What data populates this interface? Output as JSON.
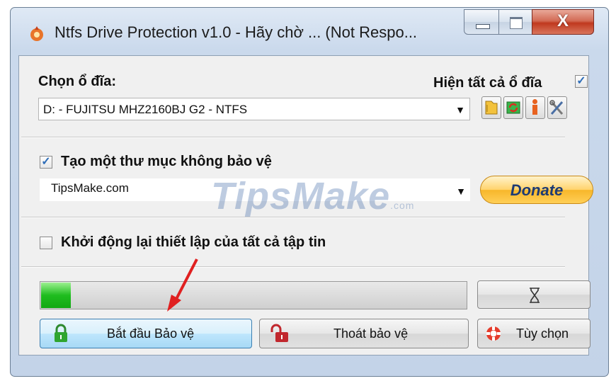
{
  "window": {
    "title": "Ntfs Drive Protection v1.0 - Hãy chờ ... (Not Respo...",
    "close_symbol": "X"
  },
  "drive": {
    "label": "Chọn ổ đĩa:",
    "show_all_label": "Hiện tất cả ổ đĩa",
    "show_all_checked": true,
    "selected": "D: - FUJITSU MHZ2160BJ G2 - NTFS",
    "tool_icons": [
      "folder-icon",
      "refresh-icon",
      "info-icon",
      "tools-icon"
    ]
  },
  "folder": {
    "checkbox_label": "Tạo một thư mục không bảo vệ",
    "checked": true,
    "value": "TipsMake.com",
    "donate_label": "Donate"
  },
  "reset": {
    "checkbox_label": "Khởi động lại thiết lập của tất cả tập tin",
    "checked": false
  },
  "progress": {
    "fraction": 0.07
  },
  "buttons": {
    "start": "Bắt đầu Bảo vệ",
    "stop": "Thoát bảo vệ",
    "options": "Tùy chọn"
  },
  "watermark": {
    "text": "TipsMake",
    "suffix": ".com"
  }
}
